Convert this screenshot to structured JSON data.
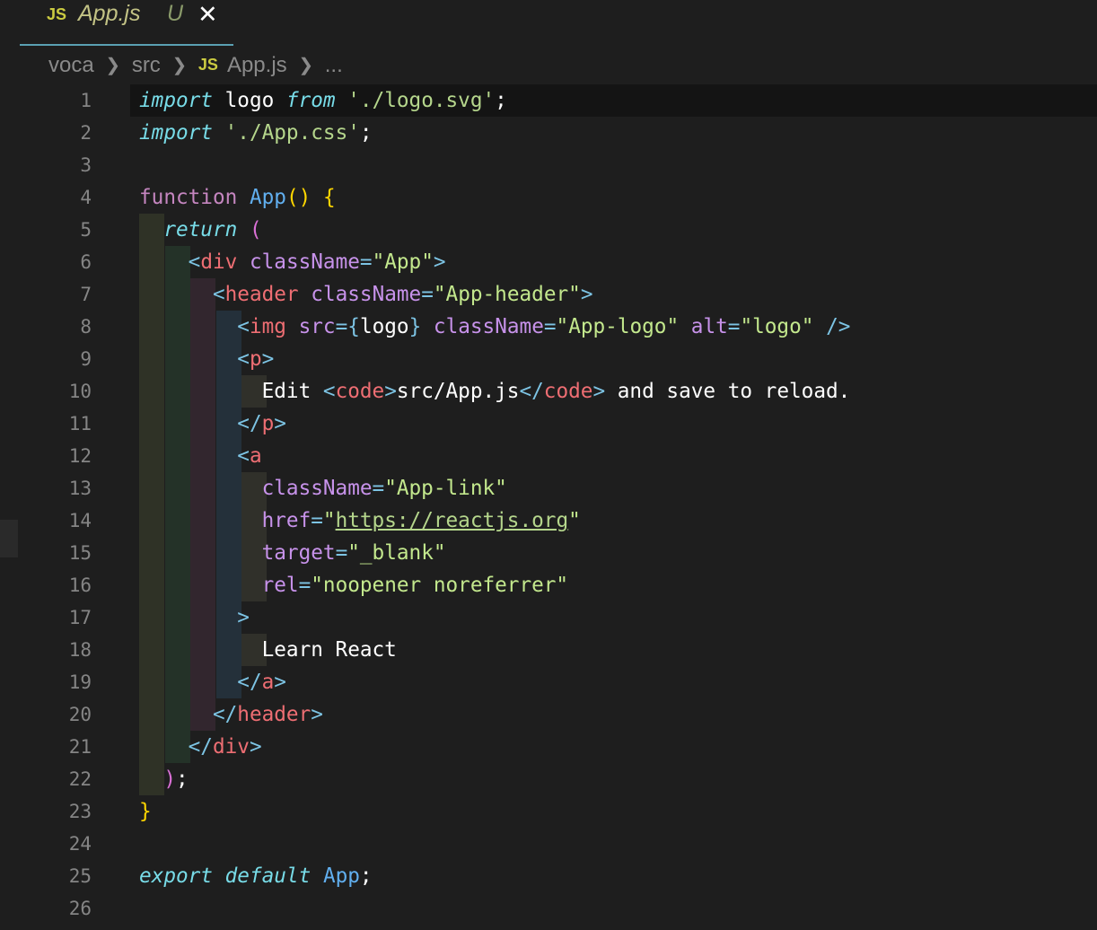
{
  "tab": {
    "icon": "JS",
    "name": "App.js",
    "status": "U",
    "close_glyph": "✕"
  },
  "breadcrumb": {
    "items": [
      "voca",
      "src",
      "App.js",
      "..."
    ],
    "file_icon": "JS"
  },
  "editor": {
    "line_numbers": [
      "1",
      "2",
      "3",
      "4",
      "5",
      "6",
      "7",
      "8",
      "9",
      "10",
      "11",
      "12",
      "13",
      "14",
      "15",
      "16",
      "17",
      "18",
      "19",
      "20",
      "21",
      "22",
      "23",
      "24",
      "25",
      "26"
    ],
    "lines": [
      [
        {
          "t": "import",
          "c": "kw-i"
        },
        {
          "t": " logo ",
          "c": "plain"
        },
        {
          "t": "from",
          "c": "kw-i"
        },
        {
          "t": " ",
          "c": "plain"
        },
        {
          "t": "'./logo.svg'",
          "c": "str"
        },
        {
          "t": ";",
          "c": "plain"
        }
      ],
      [
        {
          "t": "import",
          "c": "kw-i"
        },
        {
          "t": " ",
          "c": "plain"
        },
        {
          "t": "'./App.css'",
          "c": "str"
        },
        {
          "t": ";",
          "c": "plain"
        }
      ],
      [],
      [
        {
          "t": "function",
          "c": "kw"
        },
        {
          "t": " ",
          "c": "plain"
        },
        {
          "t": "App",
          "c": "fn"
        },
        {
          "t": "()",
          "c": "paren"
        },
        {
          "t": " ",
          "c": "plain"
        },
        {
          "t": "{",
          "c": "paren"
        }
      ],
      [
        {
          "t": "  ",
          "c": "plain"
        },
        {
          "t": "return",
          "c": "kw-i"
        },
        {
          "t": " ",
          "c": "plain"
        },
        {
          "t": "(",
          "c": "paren2"
        }
      ],
      [
        {
          "t": "    ",
          "c": "plain"
        },
        {
          "t": "<",
          "c": "punc"
        },
        {
          "t": "div",
          "c": "tag"
        },
        {
          "t": " ",
          "c": "plain"
        },
        {
          "t": "className",
          "c": "attr2"
        },
        {
          "t": "=",
          "c": "punc"
        },
        {
          "t": "\"App\"",
          "c": "attr"
        },
        {
          "t": ">",
          "c": "punc"
        }
      ],
      [
        {
          "t": "      ",
          "c": "plain"
        },
        {
          "t": "<",
          "c": "punc"
        },
        {
          "t": "header",
          "c": "tag"
        },
        {
          "t": " ",
          "c": "plain"
        },
        {
          "t": "className",
          "c": "attr2"
        },
        {
          "t": "=",
          "c": "punc"
        },
        {
          "t": "\"App-header\"",
          "c": "attr"
        },
        {
          "t": ">",
          "c": "punc"
        }
      ],
      [
        {
          "t": "        ",
          "c": "plain"
        },
        {
          "t": "<",
          "c": "punc"
        },
        {
          "t": "img",
          "c": "tag"
        },
        {
          "t": " ",
          "c": "plain"
        },
        {
          "t": "src",
          "c": "attr2"
        },
        {
          "t": "=",
          "c": "punc"
        },
        {
          "t": "{",
          "c": "punc"
        },
        {
          "t": "logo",
          "c": "plain"
        },
        {
          "t": "}",
          "c": "punc"
        },
        {
          "t": " ",
          "c": "plain"
        },
        {
          "t": "className",
          "c": "attr2"
        },
        {
          "t": "=",
          "c": "punc"
        },
        {
          "t": "\"App-logo\"",
          "c": "attr"
        },
        {
          "t": " ",
          "c": "plain"
        },
        {
          "t": "alt",
          "c": "attr2"
        },
        {
          "t": "=",
          "c": "punc"
        },
        {
          "t": "\"logo\"",
          "c": "attr"
        },
        {
          "t": " ",
          "c": "plain"
        },
        {
          "t": "/>",
          "c": "punc"
        }
      ],
      [
        {
          "t": "        ",
          "c": "plain"
        },
        {
          "t": "<",
          "c": "punc"
        },
        {
          "t": "p",
          "c": "tag"
        },
        {
          "t": ">",
          "c": "punc"
        }
      ],
      [
        {
          "t": "          ",
          "c": "plain"
        },
        {
          "t": "Edit ",
          "c": "plain"
        },
        {
          "t": "<",
          "c": "punc"
        },
        {
          "t": "code",
          "c": "tag"
        },
        {
          "t": ">",
          "c": "punc"
        },
        {
          "t": "src/App.js",
          "c": "plain"
        },
        {
          "t": "</",
          "c": "punc"
        },
        {
          "t": "code",
          "c": "tag"
        },
        {
          "t": ">",
          "c": "punc"
        },
        {
          "t": " and save to reload.",
          "c": "plain"
        }
      ],
      [
        {
          "t": "        ",
          "c": "plain"
        },
        {
          "t": "</",
          "c": "punc"
        },
        {
          "t": "p",
          "c": "tag"
        },
        {
          "t": ">",
          "c": "punc"
        }
      ],
      [
        {
          "t": "        ",
          "c": "plain"
        },
        {
          "t": "<",
          "c": "punc"
        },
        {
          "t": "a",
          "c": "tag"
        }
      ],
      [
        {
          "t": "          ",
          "c": "plain"
        },
        {
          "t": "className",
          "c": "attr2"
        },
        {
          "t": "=",
          "c": "punc"
        },
        {
          "t": "\"App-link\"",
          "c": "attr"
        }
      ],
      [
        {
          "t": "          ",
          "c": "plain"
        },
        {
          "t": "href",
          "c": "attr2"
        },
        {
          "t": "=",
          "c": "punc"
        },
        {
          "t": "\"",
          "c": "attr"
        },
        {
          "t": "https://reactjs.org",
          "c": "url"
        },
        {
          "t": "\"",
          "c": "attr"
        }
      ],
      [
        {
          "t": "          ",
          "c": "plain"
        },
        {
          "t": "target",
          "c": "attr2"
        },
        {
          "t": "=",
          "c": "punc"
        },
        {
          "t": "\"_blank\"",
          "c": "attr"
        }
      ],
      [
        {
          "t": "          ",
          "c": "plain"
        },
        {
          "t": "rel",
          "c": "attr2"
        },
        {
          "t": "=",
          "c": "punc"
        },
        {
          "t": "\"noopener noreferrer\"",
          "c": "attr"
        }
      ],
      [
        {
          "t": "        ",
          "c": "plain"
        },
        {
          "t": ">",
          "c": "punc"
        }
      ],
      [
        {
          "t": "          ",
          "c": "plain"
        },
        {
          "t": "Learn React",
          "c": "plain"
        }
      ],
      [
        {
          "t": "        ",
          "c": "plain"
        },
        {
          "t": "</",
          "c": "punc"
        },
        {
          "t": "a",
          "c": "tag"
        },
        {
          "t": ">",
          "c": "punc"
        }
      ],
      [
        {
          "t": "      ",
          "c": "plain"
        },
        {
          "t": "</",
          "c": "punc"
        },
        {
          "t": "header",
          "c": "tag"
        },
        {
          "t": ">",
          "c": "punc"
        }
      ],
      [
        {
          "t": "    ",
          "c": "plain"
        },
        {
          "t": "</",
          "c": "punc"
        },
        {
          "t": "div",
          "c": "tag"
        },
        {
          "t": ">",
          "c": "punc"
        }
      ],
      [
        {
          "t": "  ",
          "c": "plain"
        },
        {
          "t": ")",
          "c": "paren2"
        },
        {
          "t": ";",
          "c": "plain"
        }
      ],
      [
        {
          "t": "}",
          "c": "paren"
        }
      ],
      [],
      [
        {
          "t": "export",
          "c": "kw-i"
        },
        {
          "t": " ",
          "c": "plain"
        },
        {
          "t": "default",
          "c": "kw-i"
        },
        {
          "t": " ",
          "c": "plain"
        },
        {
          "t": "App",
          "c": "fn"
        },
        {
          "t": ";",
          "c": "plain"
        }
      ],
      []
    ]
  },
  "colors": {
    "background": "#1e1e1e",
    "tab_underline": "#5aa0b2",
    "current_line": "#141414",
    "indent_guides": [
      "#2f3226",
      "#243228",
      "#32262e",
      "#24303a",
      "#30302a"
    ]
  }
}
